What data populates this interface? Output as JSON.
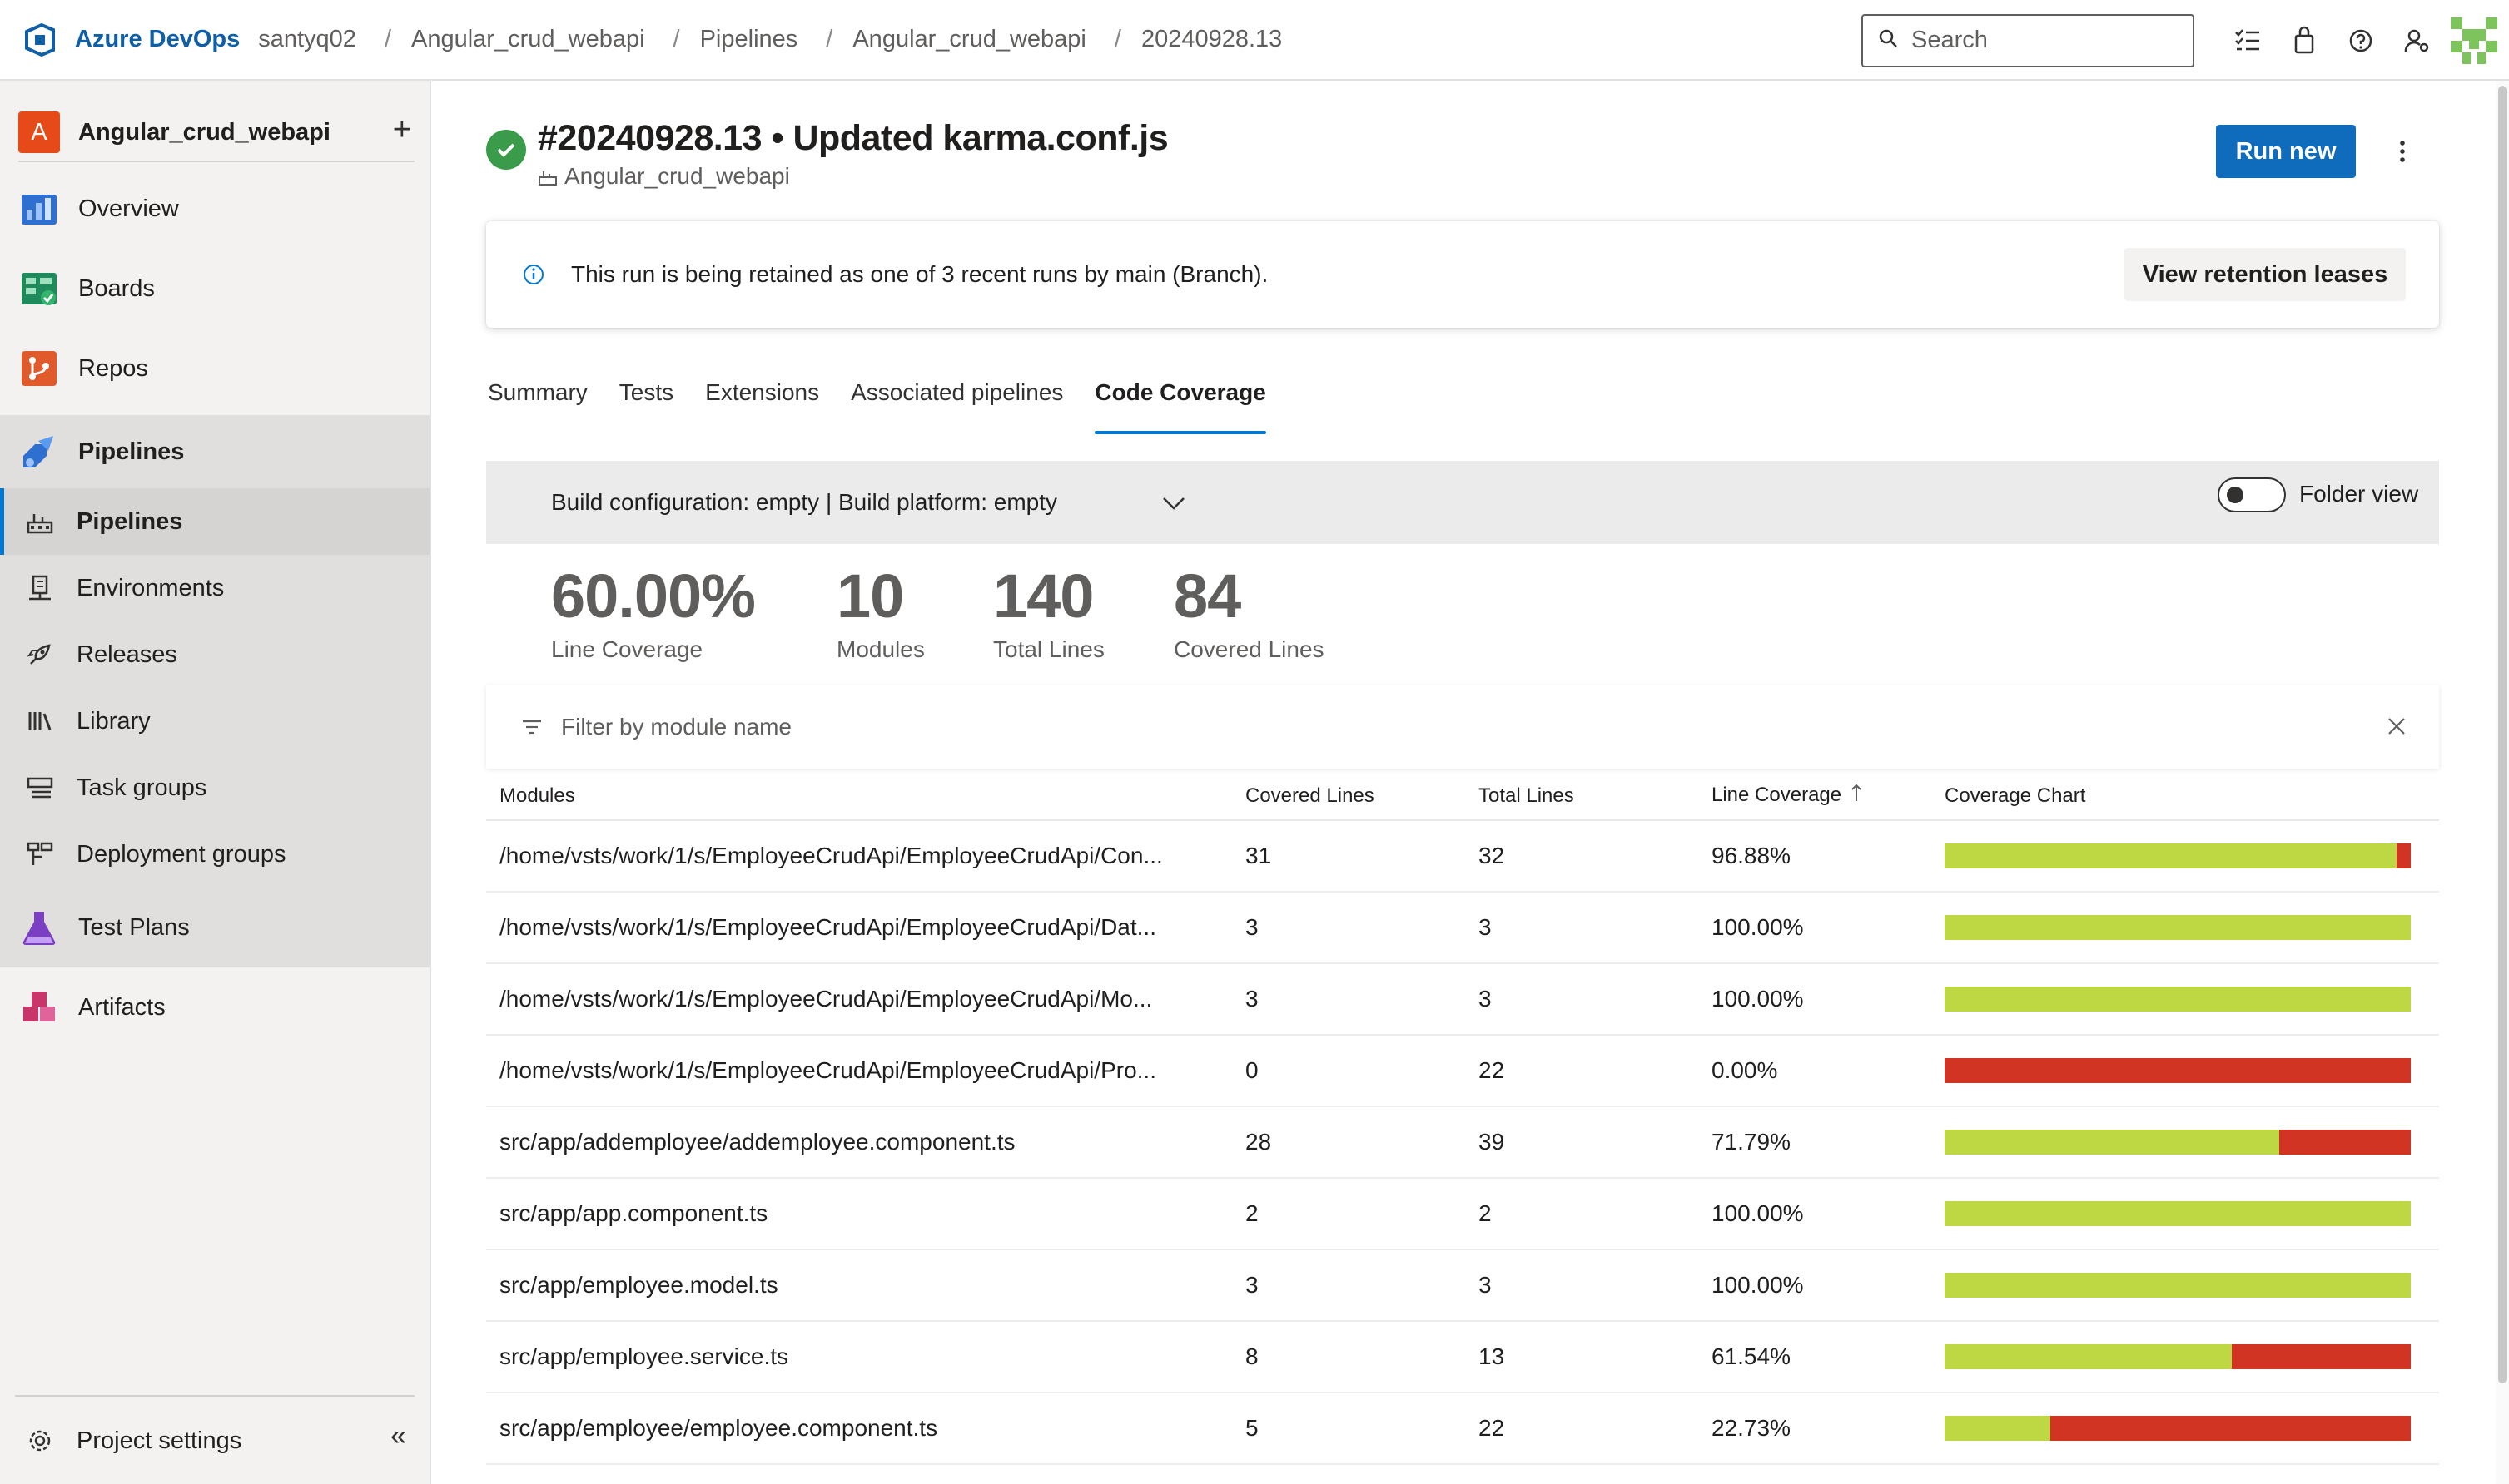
{
  "topbar": {
    "brand": "Azure DevOps",
    "breadcrumbs": [
      "santyq02",
      "Angular_crud_webapi",
      "Pipelines",
      "Angular_crud_webapi",
      "20240928.13"
    ],
    "separator": "/",
    "search_placeholder": "Search"
  },
  "sidebar": {
    "project_initial": "A",
    "project_name": "Angular_crud_webapi",
    "add_label": "+",
    "items": {
      "overview": "Overview",
      "boards": "Boards",
      "repos": "Repos",
      "pipelines": "Pipelines",
      "test_plans": "Test Plans",
      "artifacts": "Artifacts"
    },
    "pipeline_sub": {
      "pipelines": "Pipelines",
      "environments": "Environments",
      "releases": "Releases",
      "library": "Library",
      "task_groups": "Task groups",
      "deployment_groups": "Deployment groups"
    },
    "project_settings": "Project settings",
    "collapse_label": "«"
  },
  "run": {
    "title": "#20240928.13 • Updated karma.conf.js",
    "pipeline_name": "Angular_crud_webapi",
    "run_new_label": "Run new",
    "more_label": "⋮"
  },
  "banner": {
    "message": "This run is being retained as one of 3 recent runs by main (Branch).",
    "button_label": "View retention leases"
  },
  "tabs": [
    "Summary",
    "Tests",
    "Extensions",
    "Associated pipelines",
    "Code Coverage"
  ],
  "config": {
    "label": "Build configuration: empty | Build platform: empty",
    "folder_view_label": "Folder view"
  },
  "stats": {
    "line_coverage": {
      "value": "60.00%",
      "label": "Line Coverage"
    },
    "modules": {
      "value": "10",
      "label": "Modules"
    },
    "total_lines": {
      "value": "140",
      "label": "Total Lines"
    },
    "covered_lines": {
      "value": "84",
      "label": "Covered Lines"
    }
  },
  "filter": {
    "placeholder": "Filter by module name"
  },
  "table": {
    "headers": [
      "Modules",
      "Covered Lines",
      "Total Lines",
      "Line Coverage",
      "Coverage Chart"
    ],
    "rows": [
      {
        "module": "/home/vsts/work/1/s/EmployeeCrudApi/EmployeeCrudApi/Con...",
        "covered": "31",
        "total": "32",
        "coverage": "96.88%",
        "ratio": 0.9688
      },
      {
        "module": "/home/vsts/work/1/s/EmployeeCrudApi/EmployeeCrudApi/Dat...",
        "covered": "3",
        "total": "3",
        "coverage": "100.00%",
        "ratio": 1.0
      },
      {
        "module": "/home/vsts/work/1/s/EmployeeCrudApi/EmployeeCrudApi/Mo...",
        "covered": "3",
        "total": "3",
        "coverage": "100.00%",
        "ratio": 1.0
      },
      {
        "module": "/home/vsts/work/1/s/EmployeeCrudApi/EmployeeCrudApi/Pro...",
        "covered": "0",
        "total": "22",
        "coverage": "0.00%",
        "ratio": 0.0
      },
      {
        "module": "src/app/addemployee/addemployee.component.ts",
        "covered": "28",
        "total": "39",
        "coverage": "71.79%",
        "ratio": 0.7179
      },
      {
        "module": "src/app/app.component.ts",
        "covered": "2",
        "total": "2",
        "coverage": "100.00%",
        "ratio": 1.0
      },
      {
        "module": "src/app/employee.model.ts",
        "covered": "3",
        "total": "3",
        "coverage": "100.00%",
        "ratio": 1.0
      },
      {
        "module": "src/app/employee.service.ts",
        "covered": "8",
        "total": "13",
        "coverage": "61.54%",
        "ratio": 0.6154
      },
      {
        "module": "src/app/employee/employee.component.ts",
        "covered": "5",
        "total": "22",
        "coverage": "22.73%",
        "ratio": 0.2273
      }
    ]
  },
  "colors": {
    "accent": "#0078d4",
    "covered": "#bed843",
    "uncovered": "#d13423",
    "success": "#3a9b4a"
  }
}
